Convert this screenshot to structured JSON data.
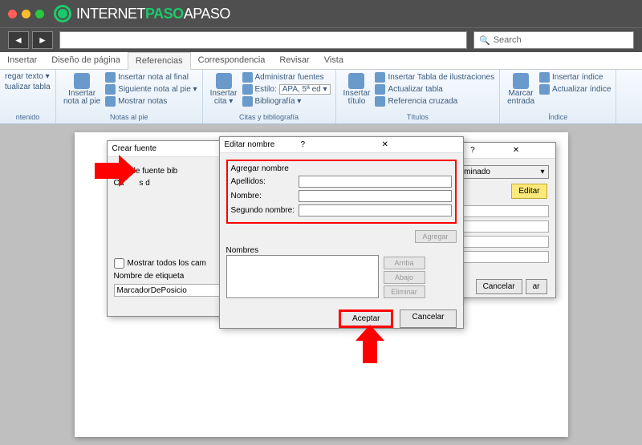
{
  "brand": {
    "prefix": "INTERNET",
    "highlight": "PASO",
    "suffix": "APASO"
  },
  "search": {
    "placeholder": "Search"
  },
  "tabs": [
    "Insertar",
    "Diseño de página",
    "Referencias",
    "Correspondencia",
    "Revisar",
    "Vista"
  ],
  "ribbon": {
    "g1": {
      "l1": "regar texto ▾",
      "l2": "tualizar tabla",
      "label": "ntenido"
    },
    "g2": {
      "btn1": "Insertar\nnota al pie",
      "l1": "Insertar nota al final",
      "l2": "Siguiente nota al pie ▾",
      "l3": "Mostrar notas",
      "label": "Notas al pie"
    },
    "g3": {
      "btn1": "Insertar\ncita ▾",
      "l1": "Administrar fuentes",
      "l2": "Estilo:",
      "style": "APA, 5ª ed ▾",
      "l3": "Bibliografía ▾",
      "label": "Citas y bibliografía"
    },
    "g4": {
      "btn1": "Insertar\ntítulo",
      "l1": "Insertar Tabla de ilustraciones",
      "l2": "Actualizar tabla",
      "l3": "Referencia cruzada",
      "label": "Títulos"
    },
    "g5": {
      "btn1": "Marcar\nentrada",
      "l1": "Insertar índice",
      "l2": "Actualizar índice",
      "label": "Índice"
    }
  },
  "dlg1": {
    "title": "Crear fuente",
    "r1": "Tipo de fuente bib",
    "r2": "Ca",
    "r2b": "s d",
    "chk": "Mostrar todos los cam",
    "lbl": "Nombre de etiqueta",
    "val": "MarcadorDePosicio"
  },
  "dlg2": {
    "sel": "redeterminado",
    "edit": "Editar",
    "ok": "ar",
    "cancel": "Cancelar"
  },
  "dlg3": {
    "title": "Editar nombre",
    "section": "Agregar nombre",
    "f1": "Apellidos:",
    "f2": "Nombre:",
    "f3": "Segundo nombre:",
    "names": "Nombres",
    "b1": "Agregar",
    "b2": "Arriba",
    "b3": "Abajo",
    "b4": "Eliminar",
    "accept": "Aceptar",
    "cancel": "Cancelar"
  }
}
